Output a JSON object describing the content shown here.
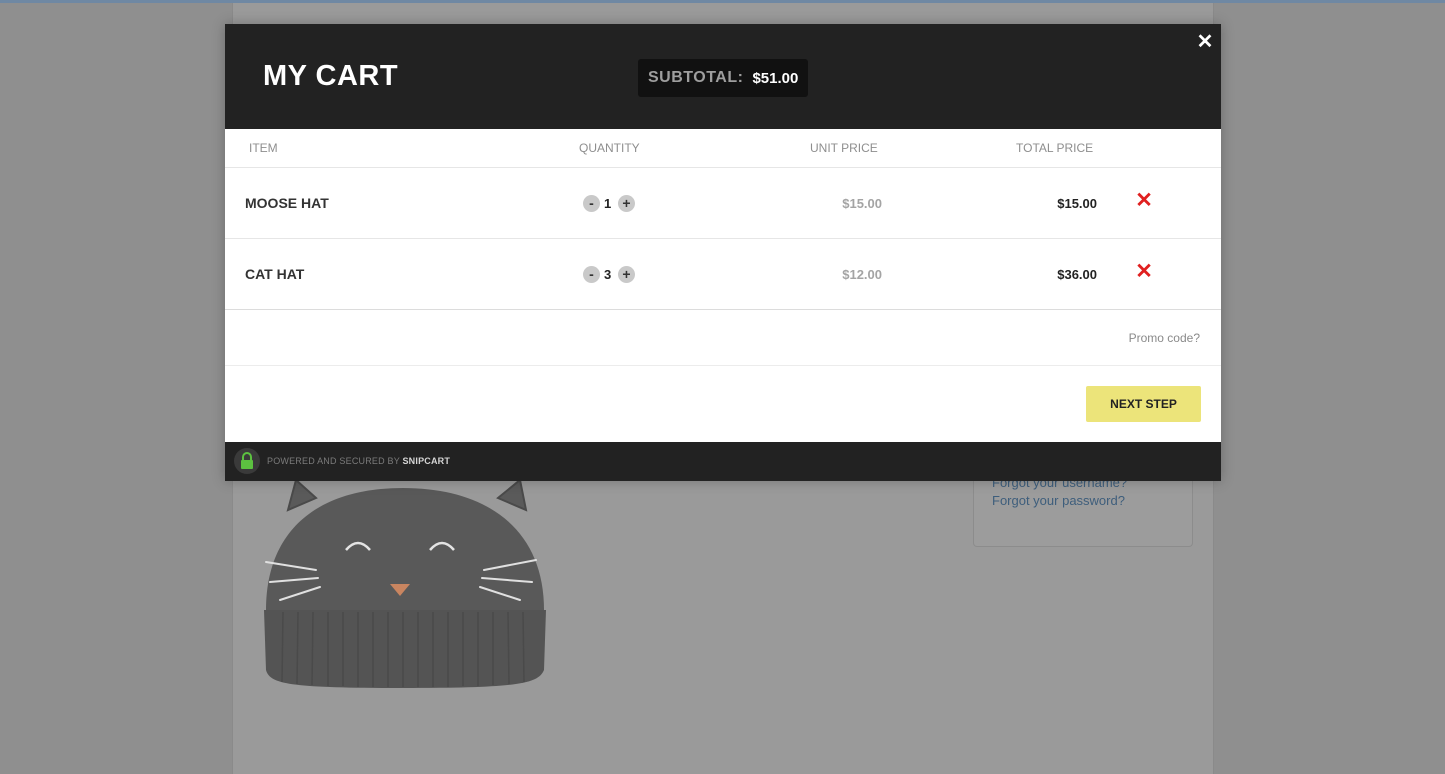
{
  "background": {
    "login_links": {
      "forgot_username": "Forgot your username?",
      "forgot_password": "Forgot your password?"
    },
    "product_image_icon": "cat-hat-image"
  },
  "cart": {
    "title": "MY CART",
    "subtotal_label": "SUBTOTAL:",
    "subtotal_value": "$51.00",
    "close_icon": "close-icon",
    "columns": [
      "ITEM",
      "QUANTITY",
      "UNIT PRICE",
      "TOTAL PRICE"
    ],
    "items": [
      {
        "name": "MOOSE HAT",
        "quantity": "1",
        "unit_price": "$15.00",
        "total_price": "$15.00",
        "minus_label": "-",
        "plus_label": "+",
        "remove_label": "✕"
      },
      {
        "name": "CAT HAT",
        "quantity": "3",
        "unit_price": "$12.00",
        "total_price": "$36.00",
        "minus_label": "-",
        "plus_label": "+",
        "remove_label": "✕"
      }
    ],
    "promo_label": "Promo code?",
    "next_label": "NEXT STEP",
    "footer": {
      "powered_text": "POWERED AND SECURED BY",
      "brand": "SNIPCART",
      "lock_icon": "lock-icon"
    }
  },
  "colors": {
    "header_bg": "#222222",
    "accent_yellow": "#ece47a",
    "remove_red": "#e02020",
    "lock_green": "#5cc140"
  }
}
